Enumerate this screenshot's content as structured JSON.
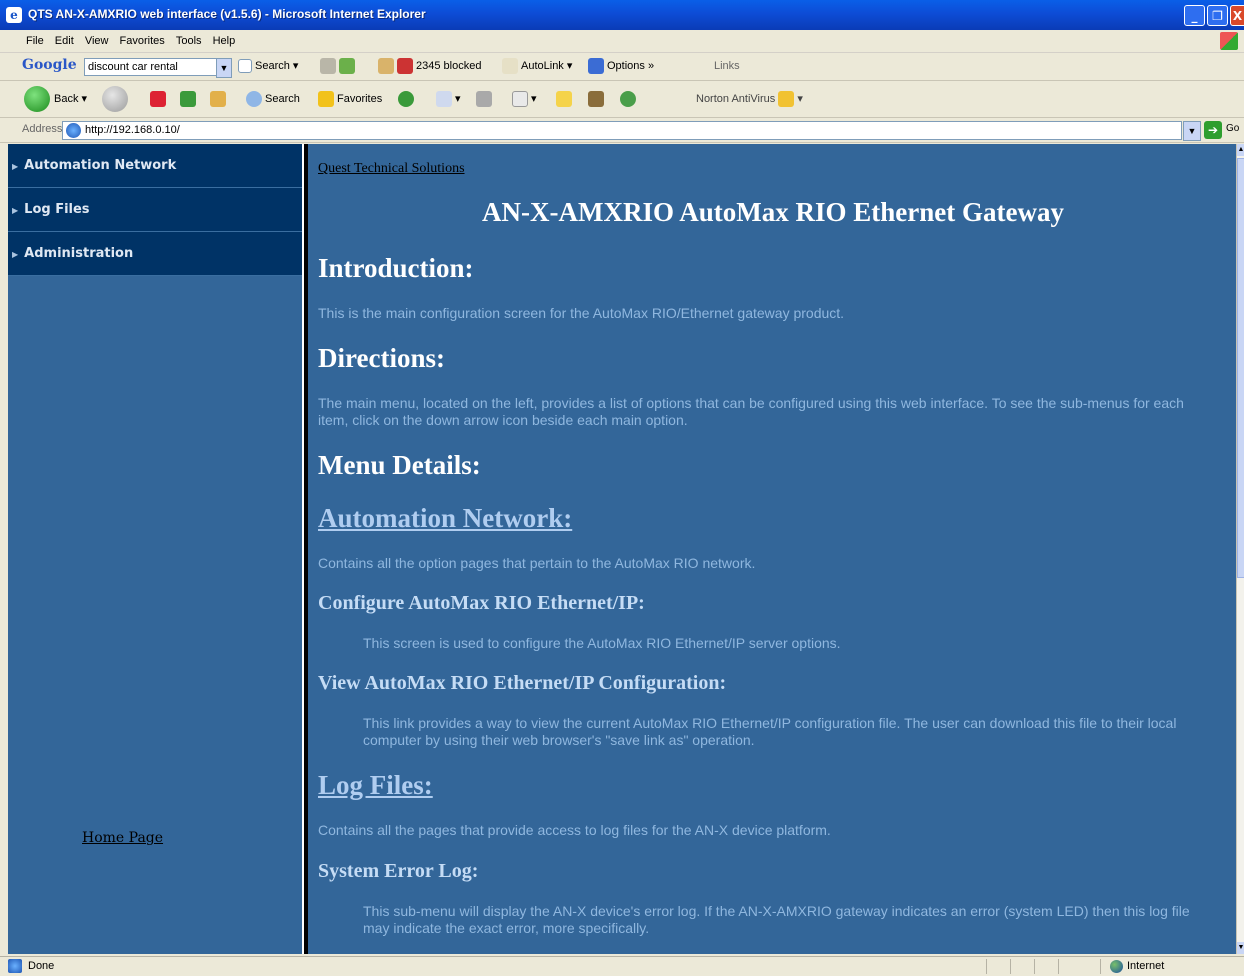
{
  "window": {
    "title": "QTS AN-X-AMXRIO web interface (v1.5.6) - Microsoft Internet Explorer",
    "min_glyph": "_",
    "max_glyph": "❐",
    "close_glyph": "X"
  },
  "menu": [
    "File",
    "Edit",
    "View",
    "Favorites",
    "Tools",
    "Help"
  ],
  "google_bar": {
    "logo": "Google",
    "search_value": "discount car rental",
    "search_label": "Search",
    "blocked_label": "2345 blocked",
    "autolink_label": "AutoLink",
    "options_label": "Options",
    "more": "»",
    "links_label": "Links"
  },
  "std_toolbar": {
    "back_label": "Back",
    "search_label": "Search",
    "favorites_label": "Favorites",
    "norton_label": "Norton AntiVirus"
  },
  "address": {
    "label": "Address",
    "url": "http://192.168.0.10/",
    "go_label": "Go"
  },
  "sidebar": {
    "items": [
      {
        "label": "Automation Network"
      },
      {
        "label": "Log Files"
      },
      {
        "label": "Administration"
      }
    ],
    "home_link": "Home Page"
  },
  "main": {
    "company_link": "Quest Technical Solutions",
    "title": "AN-X-AMXRIO AutoMax RIO Ethernet Gateway",
    "intro_heading": "Introduction:",
    "intro_text": "This is the main configuration screen for the AutoMax RIO/Ethernet gateway product.",
    "directions_heading": "Directions:",
    "directions_text": "The main menu, located on the left, provides a list of options that can be configured using this web interface. To see the sub-menus for each item, click on the down arrow icon beside each main option.",
    "menu_details_heading": "Menu Details:",
    "automation_link": "Automation Network:",
    "automation_text": "Contains all the option pages that pertain to the AutoMax RIO network.",
    "configure_heading": "Configure AutoMax RIO Ethernet/IP:",
    "configure_text": "This screen is used to configure the AutoMax RIO Ethernet/IP server options.",
    "view_heading": "View AutoMax RIO Ethernet/IP Configuration:",
    "view_text": "This link provides a way to view the current AutoMax RIO Ethernet/IP configuration file. The user can download this file to their local computer by using their web browser's \"save link as\" operation.",
    "logfiles_link": "Log Files:",
    "logfiles_text": "Contains all the pages that provide access to log files for the AN-X device platform.",
    "syserr_heading": "System Error Log:",
    "syserr_text": "This sub-menu will display the AN-X device's error log. If the AN-X-AMXRIO gateway indicates an error (system LED) then this log file may indicate the exact error, more specifically."
  },
  "status": {
    "text": "Done",
    "zone": "Internet"
  }
}
